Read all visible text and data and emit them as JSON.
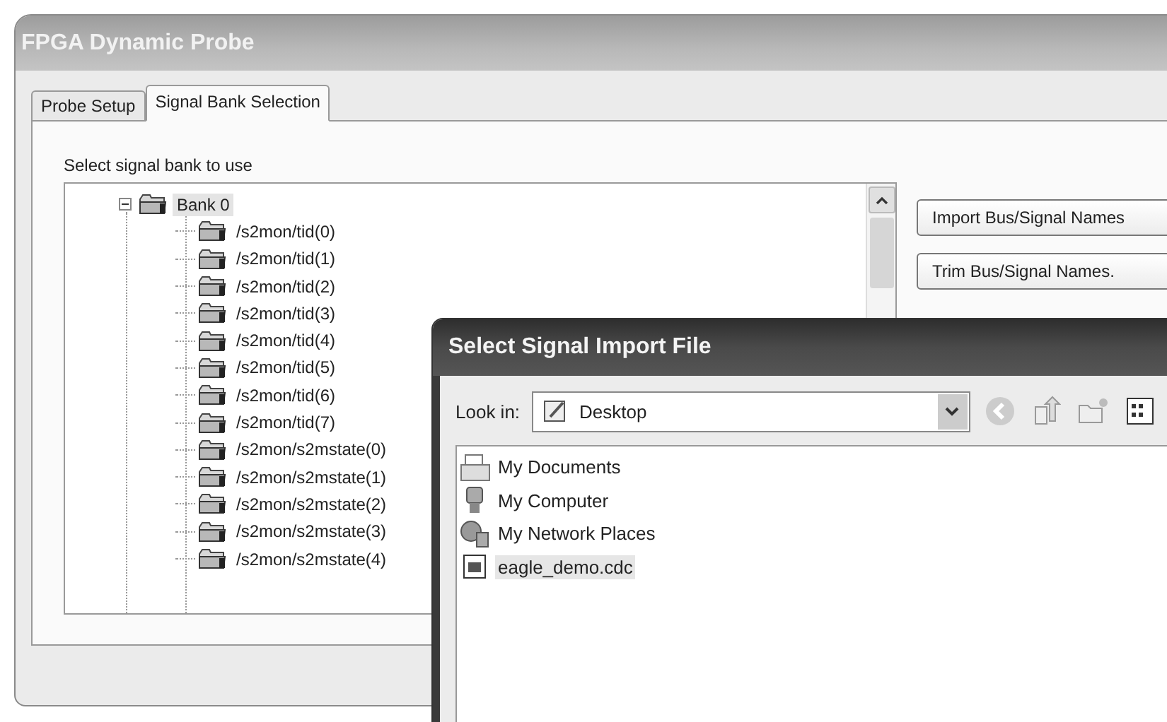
{
  "window": {
    "title": "FPGA Dynamic Probe"
  },
  "tabs": [
    {
      "label": "Probe Setup",
      "selected": false
    },
    {
      "label": "Signal Bank Selection",
      "selected": true
    }
  ],
  "tree": {
    "label": "Select signal bank to use",
    "items": [
      {
        "label": "Bank  0",
        "expanded": true,
        "selected": true,
        "children": [
          {
            "label": "/s2mon/tid(0)",
            "selected": false
          },
          {
            "label": "/s2mon/tid(1)",
            "selected": false
          },
          {
            "label": "/s2mon/tid(2)",
            "selected": false
          },
          {
            "label": "/s2mon/tid(3)",
            "selected": false
          },
          {
            "label": "/s2mon/tid(4)",
            "selected": false
          },
          {
            "label": "/s2mon/tid(5)",
            "selected": false
          },
          {
            "label": "/s2mon/tid(6)",
            "selected": false
          },
          {
            "label": "/s2mon/tid(7)",
            "selected": false
          },
          {
            "label": "/s2mon/s2mstate(0)",
            "selected": false
          },
          {
            "label": "/s2mon/s2mstate(1)",
            "selected": false
          },
          {
            "label": "/s2mon/s2mstate(2)",
            "selected": false
          },
          {
            "label": "/s2mon/s2mstate(3)",
            "selected": false
          },
          {
            "label": "/s2mon/s2mstate(4)",
            "selected": false
          }
        ]
      }
    ]
  },
  "buttons": [
    "Import Bus/Signal Names",
    "Trim Bus/Signal Names."
  ],
  "dialog": {
    "title": "Select Signal Import File",
    "look_in_label": "Look in:",
    "look_in_value": "Desktop",
    "files": [
      {
        "kind": "documents",
        "name": "My Documents",
        "selected": false
      },
      {
        "kind": "computer",
        "name": "My Computer",
        "selected": false
      },
      {
        "kind": "network",
        "name": "My Network Places",
        "selected": false
      },
      {
        "kind": "file",
        "name": "eagle_demo.cdc",
        "selected": true
      }
    ]
  }
}
